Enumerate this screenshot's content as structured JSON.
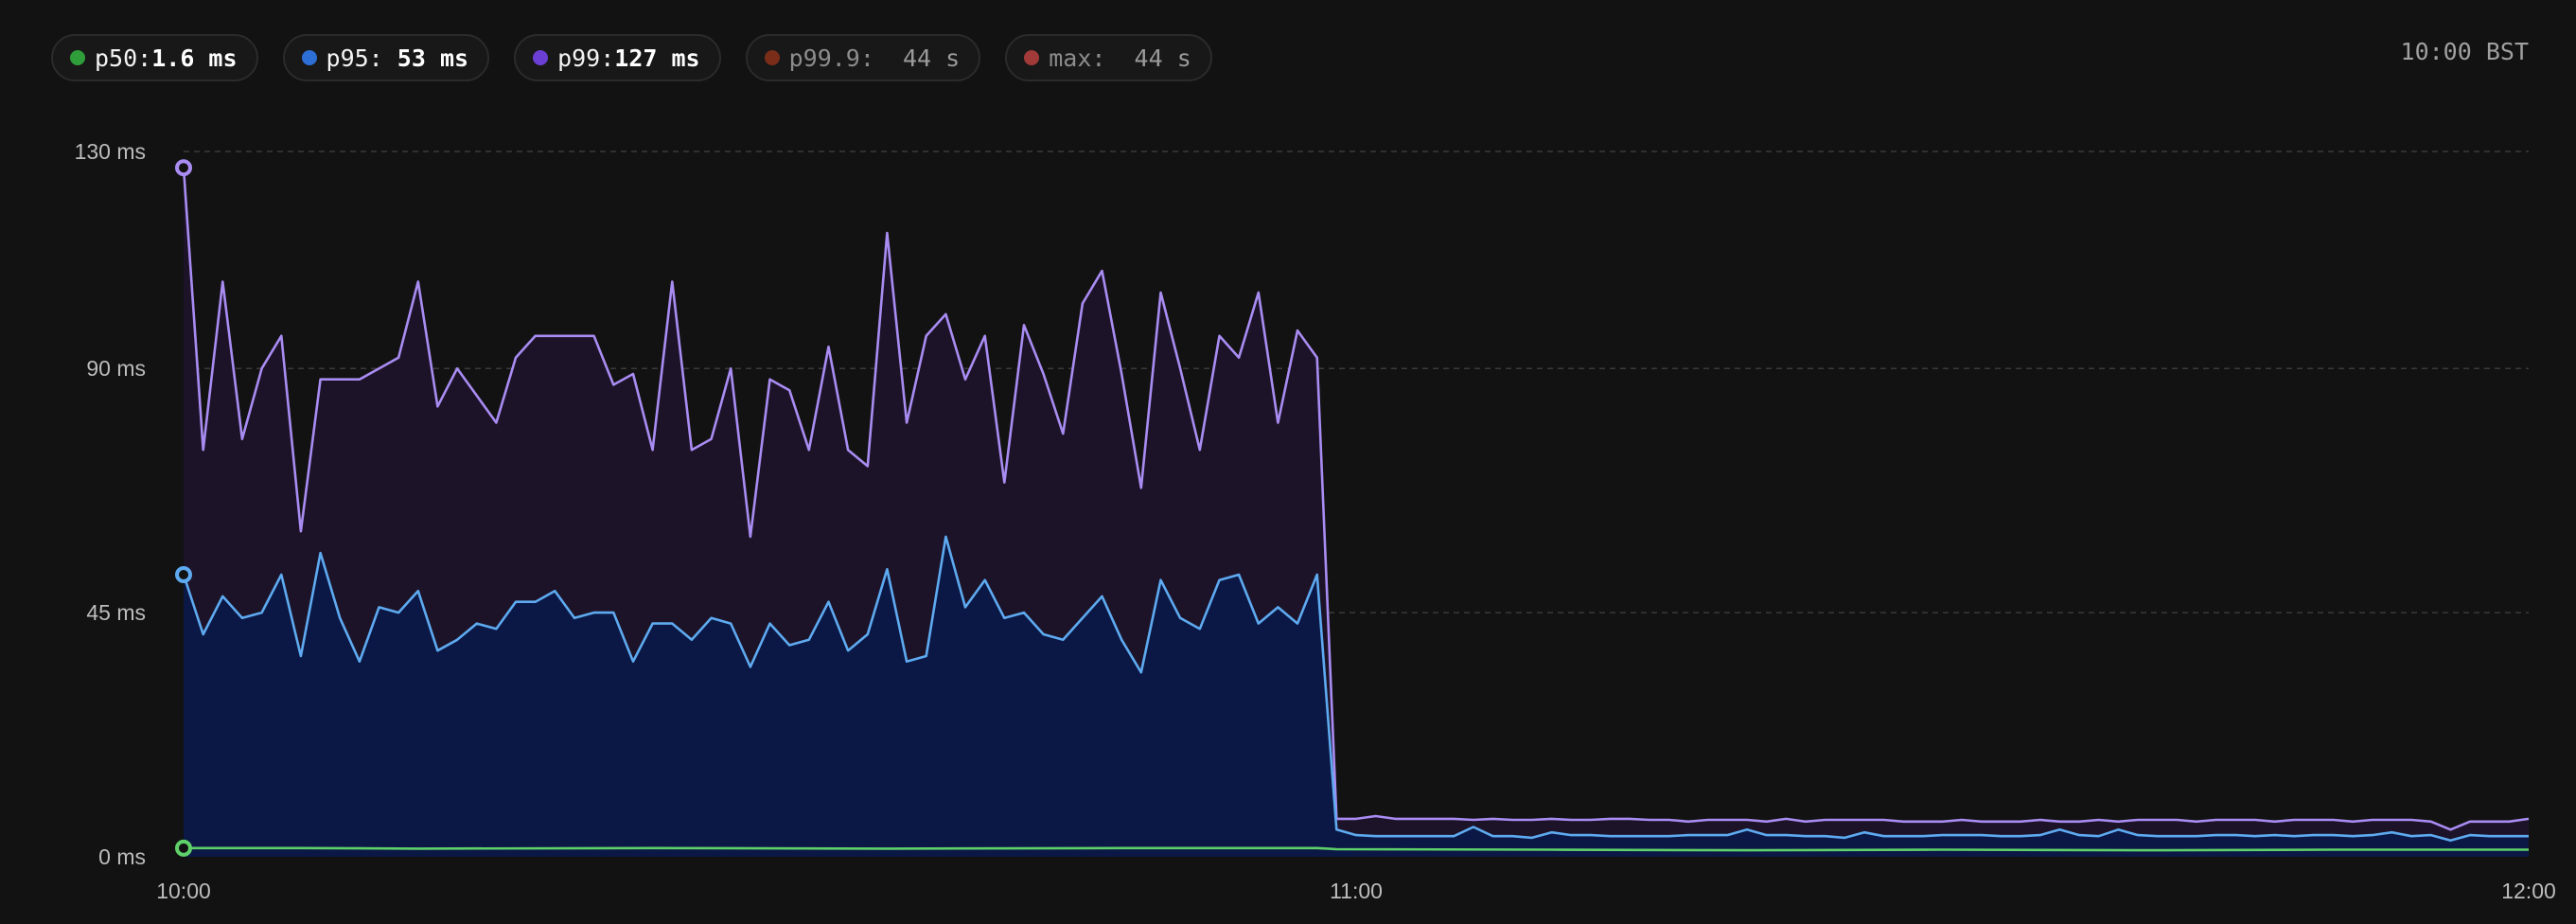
{
  "legend": [
    {
      "name": "p50:",
      "value": "1.6 ms",
      "color": "#2f9e3a",
      "dim": false
    },
    {
      "name": "p95:",
      "value": " 53 ms",
      "color": "#2e6fd6",
      "dim": false
    },
    {
      "name": "p99:",
      "value": "127 ms",
      "color": "#6b3fd4",
      "dim": false
    },
    {
      "name": "p99.9:",
      "value": "  44 s",
      "color": "#7a2e1a",
      "dim": true
    },
    {
      "name": "max:",
      "value": "  44 s",
      "color": "#a33a3a",
      "dim": true
    }
  ],
  "timezone_label": "10:00 BST",
  "chart_data": {
    "type": "area",
    "x_unit": "minutes since 10:00",
    "xlim": [
      0,
      120
    ],
    "ylim": [
      0,
      130
    ],
    "y_ticks": [
      {
        "value": 0,
        "label": "0 ms"
      },
      {
        "value": 45,
        "label": "45 ms"
      },
      {
        "value": 90,
        "label": "90 ms"
      },
      {
        "value": 130,
        "label": "130 ms"
      }
    ],
    "x_ticks": [
      {
        "value": 0,
        "label": "10:00"
      },
      {
        "value": 60,
        "label": "11:00"
      },
      {
        "value": 120,
        "label": "12:00"
      }
    ],
    "grid": true,
    "series": [
      {
        "name": "p99",
        "color": "#a98cf2",
        "fill": "#1c1329",
        "marker_at_start": true,
        "points": [
          [
            0,
            127
          ],
          [
            1,
            75
          ],
          [
            2,
            106
          ],
          [
            3,
            77
          ],
          [
            4,
            90
          ],
          [
            5,
            96
          ],
          [
            6,
            60
          ],
          [
            7,
            88
          ],
          [
            8,
            88
          ],
          [
            9,
            88
          ],
          [
            10,
            90
          ],
          [
            11,
            92
          ],
          [
            12,
            106
          ],
          [
            13,
            83
          ],
          [
            14,
            90
          ],
          [
            15,
            85
          ],
          [
            16,
            80
          ],
          [
            17,
            92
          ],
          [
            18,
            96
          ],
          [
            19,
            96
          ],
          [
            20,
            96
          ],
          [
            21,
            96
          ],
          [
            22,
            87
          ],
          [
            23,
            89
          ],
          [
            24,
            75
          ],
          [
            25,
            106
          ],
          [
            26,
            75
          ],
          [
            27,
            77
          ],
          [
            28,
            90
          ],
          [
            29,
            59
          ],
          [
            30,
            88
          ],
          [
            31,
            86
          ],
          [
            32,
            75
          ],
          [
            33,
            94
          ],
          [
            34,
            75
          ],
          [
            35,
            72
          ],
          [
            36,
            115
          ],
          [
            37,
            80
          ],
          [
            38,
            96
          ],
          [
            39,
            100
          ],
          [
            40,
            88
          ],
          [
            41,
            96
          ],
          [
            42,
            69
          ],
          [
            43,
            98
          ],
          [
            44,
            89
          ],
          [
            45,
            78
          ],
          [
            46,
            102
          ],
          [
            47,
            108
          ],
          [
            48,
            89
          ],
          [
            49,
            68
          ],
          [
            50,
            104
          ],
          [
            51,
            90
          ],
          [
            52,
            75
          ],
          [
            53,
            96
          ],
          [
            54,
            92
          ],
          [
            55,
            104
          ],
          [
            56,
            80
          ],
          [
            57,
            97
          ],
          [
            58,
            92
          ],
          [
            59,
            7
          ],
          [
            60,
            7
          ],
          [
            61,
            7.5
          ],
          [
            62,
            7
          ],
          [
            63,
            7
          ],
          [
            64,
            7
          ],
          [
            65,
            7
          ],
          [
            66,
            6.8
          ],
          [
            67,
            7
          ],
          [
            68,
            6.8
          ],
          [
            69,
            6.8
          ],
          [
            70,
            7
          ],
          [
            71,
            6.8
          ],
          [
            72,
            6.8
          ],
          [
            73,
            7
          ],
          [
            74,
            7
          ],
          [
            75,
            6.8
          ],
          [
            76,
            6.8
          ],
          [
            77,
            6.5
          ],
          [
            78,
            6.8
          ],
          [
            79,
            6.8
          ],
          [
            80,
            6.8
          ],
          [
            81,
            6.5
          ],
          [
            82,
            7
          ],
          [
            83,
            6.5
          ],
          [
            84,
            6.8
          ],
          [
            85,
            6.8
          ],
          [
            86,
            6.8
          ],
          [
            87,
            6.8
          ],
          [
            88,
            6.5
          ],
          [
            89,
            6.5
          ],
          [
            90,
            6.5
          ],
          [
            91,
            6.8
          ],
          [
            92,
            6.5
          ],
          [
            93,
            6.5
          ],
          [
            94,
            6.5
          ],
          [
            95,
            6.8
          ],
          [
            96,
            6.5
          ],
          [
            97,
            6.5
          ],
          [
            98,
            6.8
          ],
          [
            99,
            6.5
          ],
          [
            100,
            6.8
          ],
          [
            101,
            6.8
          ],
          [
            102,
            6.8
          ],
          [
            103,
            6.5
          ],
          [
            104,
            6.8
          ],
          [
            105,
            6.8
          ],
          [
            106,
            6.8
          ],
          [
            107,
            6.5
          ],
          [
            108,
            6.8
          ],
          [
            109,
            6.8
          ],
          [
            110,
            6.8
          ],
          [
            111,
            6.5
          ],
          [
            112,
            6.8
          ],
          [
            113,
            6.8
          ],
          [
            114,
            6.8
          ],
          [
            115,
            6.5
          ],
          [
            116,
            5
          ],
          [
            117,
            6.5
          ],
          [
            118,
            6.5
          ],
          [
            119,
            6.5
          ],
          [
            120,
            7
          ]
        ]
      },
      {
        "name": "p95",
        "color": "#5eaaf0",
        "fill": "#0b1845",
        "marker_at_start": true,
        "points": [
          [
            0,
            52
          ],
          [
            1,
            41
          ],
          [
            2,
            48
          ],
          [
            3,
            44
          ],
          [
            4,
            45
          ],
          [
            5,
            52
          ],
          [
            6,
            37
          ],
          [
            7,
            56
          ],
          [
            8,
            44
          ],
          [
            9,
            36
          ],
          [
            10,
            46
          ],
          [
            11,
            45
          ],
          [
            12,
            49
          ],
          [
            13,
            38
          ],
          [
            14,
            40
          ],
          [
            15,
            43
          ],
          [
            16,
            42
          ],
          [
            17,
            47
          ],
          [
            18,
            47
          ],
          [
            19,
            49
          ],
          [
            20,
            44
          ],
          [
            21,
            45
          ],
          [
            22,
            45
          ],
          [
            23,
            36
          ],
          [
            24,
            43
          ],
          [
            25,
            43
          ],
          [
            26,
            40
          ],
          [
            27,
            44
          ],
          [
            28,
            43
          ],
          [
            29,
            35
          ],
          [
            30,
            43
          ],
          [
            31,
            39
          ],
          [
            32,
            40
          ],
          [
            33,
            47
          ],
          [
            34,
            38
          ],
          [
            35,
            41
          ],
          [
            36,
            53
          ],
          [
            37,
            36
          ],
          [
            38,
            37
          ],
          [
            39,
            59
          ],
          [
            40,
            46
          ],
          [
            41,
            51
          ],
          [
            42,
            44
          ],
          [
            43,
            45
          ],
          [
            44,
            41
          ],
          [
            45,
            40
          ],
          [
            46,
            44
          ],
          [
            47,
            48
          ],
          [
            48,
            40
          ],
          [
            49,
            34
          ],
          [
            50,
            51
          ],
          [
            51,
            44
          ],
          [
            52,
            42
          ],
          [
            53,
            51
          ],
          [
            54,
            52
          ],
          [
            55,
            43
          ],
          [
            56,
            46
          ],
          [
            57,
            43
          ],
          [
            58,
            52
          ],
          [
            59,
            5
          ],
          [
            60,
            4
          ],
          [
            61,
            3.8
          ],
          [
            62,
            3.8
          ],
          [
            63,
            3.8
          ],
          [
            64,
            3.8
          ],
          [
            65,
            3.8
          ],
          [
            66,
            5.5
          ],
          [
            67,
            3.8
          ],
          [
            68,
            3.8
          ],
          [
            69,
            3.5
          ],
          [
            70,
            4.5
          ],
          [
            71,
            4
          ],
          [
            72,
            4
          ],
          [
            73,
            3.8
          ],
          [
            74,
            3.8
          ],
          [
            75,
            3.8
          ],
          [
            76,
            3.8
          ],
          [
            77,
            4
          ],
          [
            78,
            4
          ],
          [
            79,
            4
          ],
          [
            80,
            5
          ],
          [
            81,
            4
          ],
          [
            82,
            4
          ],
          [
            83,
            3.8
          ],
          [
            84,
            3.8
          ],
          [
            85,
            3.5
          ],
          [
            86,
            4.5
          ],
          [
            87,
            3.8
          ],
          [
            88,
            3.8
          ],
          [
            89,
            3.8
          ],
          [
            90,
            4
          ],
          [
            91,
            4
          ],
          [
            92,
            4
          ],
          [
            93,
            3.8
          ],
          [
            94,
            3.8
          ],
          [
            95,
            4
          ],
          [
            96,
            5
          ],
          [
            97,
            4
          ],
          [
            98,
            3.8
          ],
          [
            99,
            5
          ],
          [
            100,
            4
          ],
          [
            101,
            3.8
          ],
          [
            102,
            3.8
          ],
          [
            103,
            3.8
          ],
          [
            104,
            4
          ],
          [
            105,
            4
          ],
          [
            106,
            3.8
          ],
          [
            107,
            4
          ],
          [
            108,
            3.8
          ],
          [
            109,
            4
          ],
          [
            110,
            4
          ],
          [
            111,
            3.8
          ],
          [
            112,
            4
          ],
          [
            113,
            4.5
          ],
          [
            114,
            3.8
          ],
          [
            115,
            4
          ],
          [
            116,
            3
          ],
          [
            117,
            4
          ],
          [
            118,
            3.8
          ],
          [
            119,
            3.8
          ],
          [
            120,
            3.8
          ]
        ]
      },
      {
        "name": "p50",
        "color": "#5ed16a",
        "fill": "",
        "marker_at_start": true,
        "points": [
          [
            0,
            1.6
          ],
          [
            6,
            1.6
          ],
          [
            12,
            1.5
          ],
          [
            24,
            1.6
          ],
          [
            36,
            1.5
          ],
          [
            48,
            1.6
          ],
          [
            58,
            1.6
          ],
          [
            59,
            1.4
          ],
          [
            70,
            1.3
          ],
          [
            80,
            1.2
          ],
          [
            90,
            1.3
          ],
          [
            100,
            1.2
          ],
          [
            110,
            1.3
          ],
          [
            120,
            1.3
          ]
        ]
      }
    ]
  }
}
